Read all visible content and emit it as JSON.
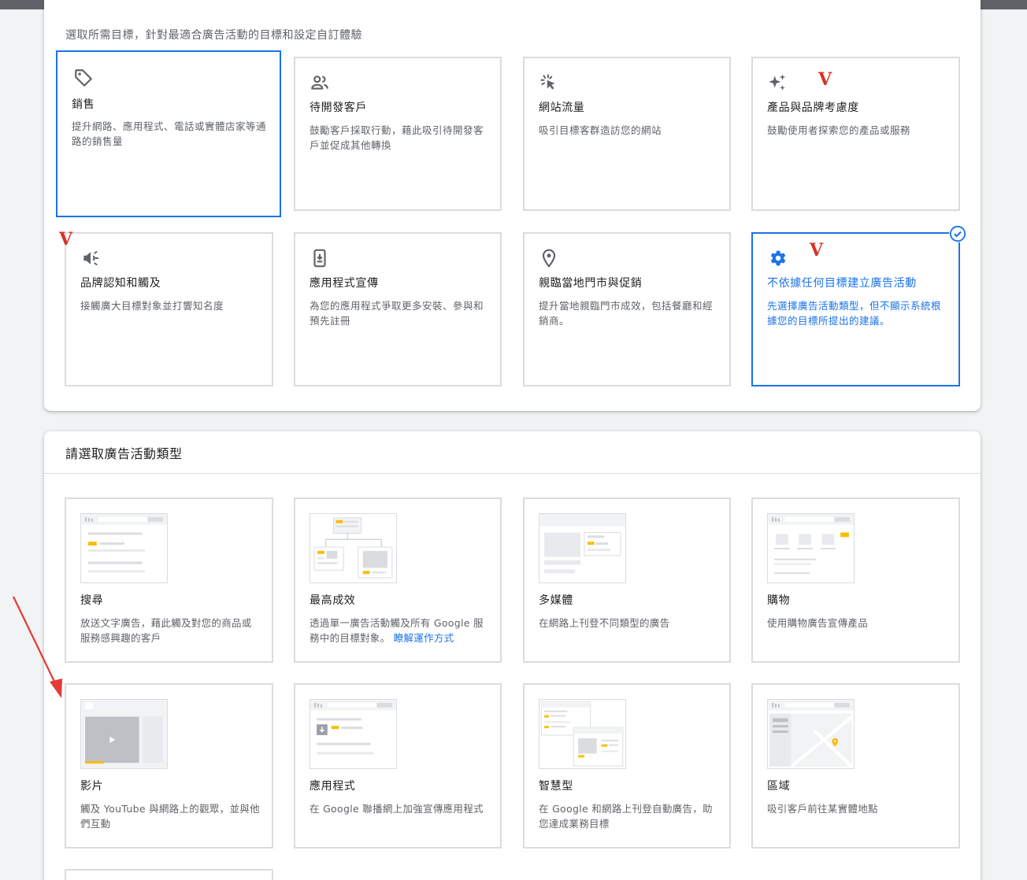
{
  "goals": {
    "caption": "選取所需目標，針對最適合廣告活動的目標和設定自訂體驗",
    "cards": [
      {
        "title": "銷售",
        "desc": "提升網路、應用程式、電話或實體店家等通路的銷售量",
        "icon": "tag-icon"
      },
      {
        "title": "待開發客戶",
        "desc": "鼓勵客戶採取行動，藉此吸引待開發客戶並促成其他轉換",
        "icon": "people-icon"
      },
      {
        "title": "網站流量",
        "desc": "吸引目標客群造訪您的網站",
        "icon": "cursor-click-icon"
      },
      {
        "title": "產品與品牌考慮度",
        "desc": "鼓勵使用者探索您的產品或服務",
        "icon": "sparkle-icon"
      },
      {
        "title": "品牌認知和觸及",
        "desc": "接觸廣大目標對象並打響知名度",
        "icon": "megaphone-icon"
      },
      {
        "title": "應用程式宣傳",
        "desc": "為您的應用程式爭取更多安裝、參與和預先註冊",
        "icon": "phone-download-icon"
      },
      {
        "title": "親臨當地門市與促銷",
        "desc": "提升當地親臨門市成效，包括餐廳和經銷商。",
        "icon": "location-pin-icon"
      },
      {
        "title": "不依據任何目標建立廣告活動",
        "desc": "先選擇廣告活動類型，但不顯示系統根據您的目標所提出的建議。",
        "icon": "gear-icon"
      }
    ]
  },
  "types": {
    "title": "請選取廣告活動類型",
    "cards": [
      {
        "title": "搜尋",
        "desc": "放送文字廣告，藉此觸及對您的商品或服務感興趣的客戶"
      },
      {
        "title": "最高成效",
        "desc": "透過單一廣告活動觸及所有 Google 服務中的目標對象。",
        "link": "瞭解運作方式"
      },
      {
        "title": "多媒體",
        "desc": "在網路上刊登不同類型的廣告"
      },
      {
        "title": "購物",
        "desc": "使用購物廣告宣傳產品"
      },
      {
        "title": "影片",
        "desc": "觸及 YouTube 與網路上的觀眾，並與他們互動"
      },
      {
        "title": "應用程式",
        "desc": "在 Google 聯播網上加強宣傳應用程式"
      },
      {
        "title": "智慧型",
        "desc": "在 Google 和網路上刊登自動廣告，助您達成業務目標"
      },
      {
        "title": "區域",
        "desc": "吸引客戶前往某實體地點"
      }
    ]
  },
  "annotations": {
    "v_mark": "V"
  },
  "colors": {
    "accent": "#1a73e8",
    "highlight": "#fbbc04",
    "annotation": "#d93025"
  }
}
